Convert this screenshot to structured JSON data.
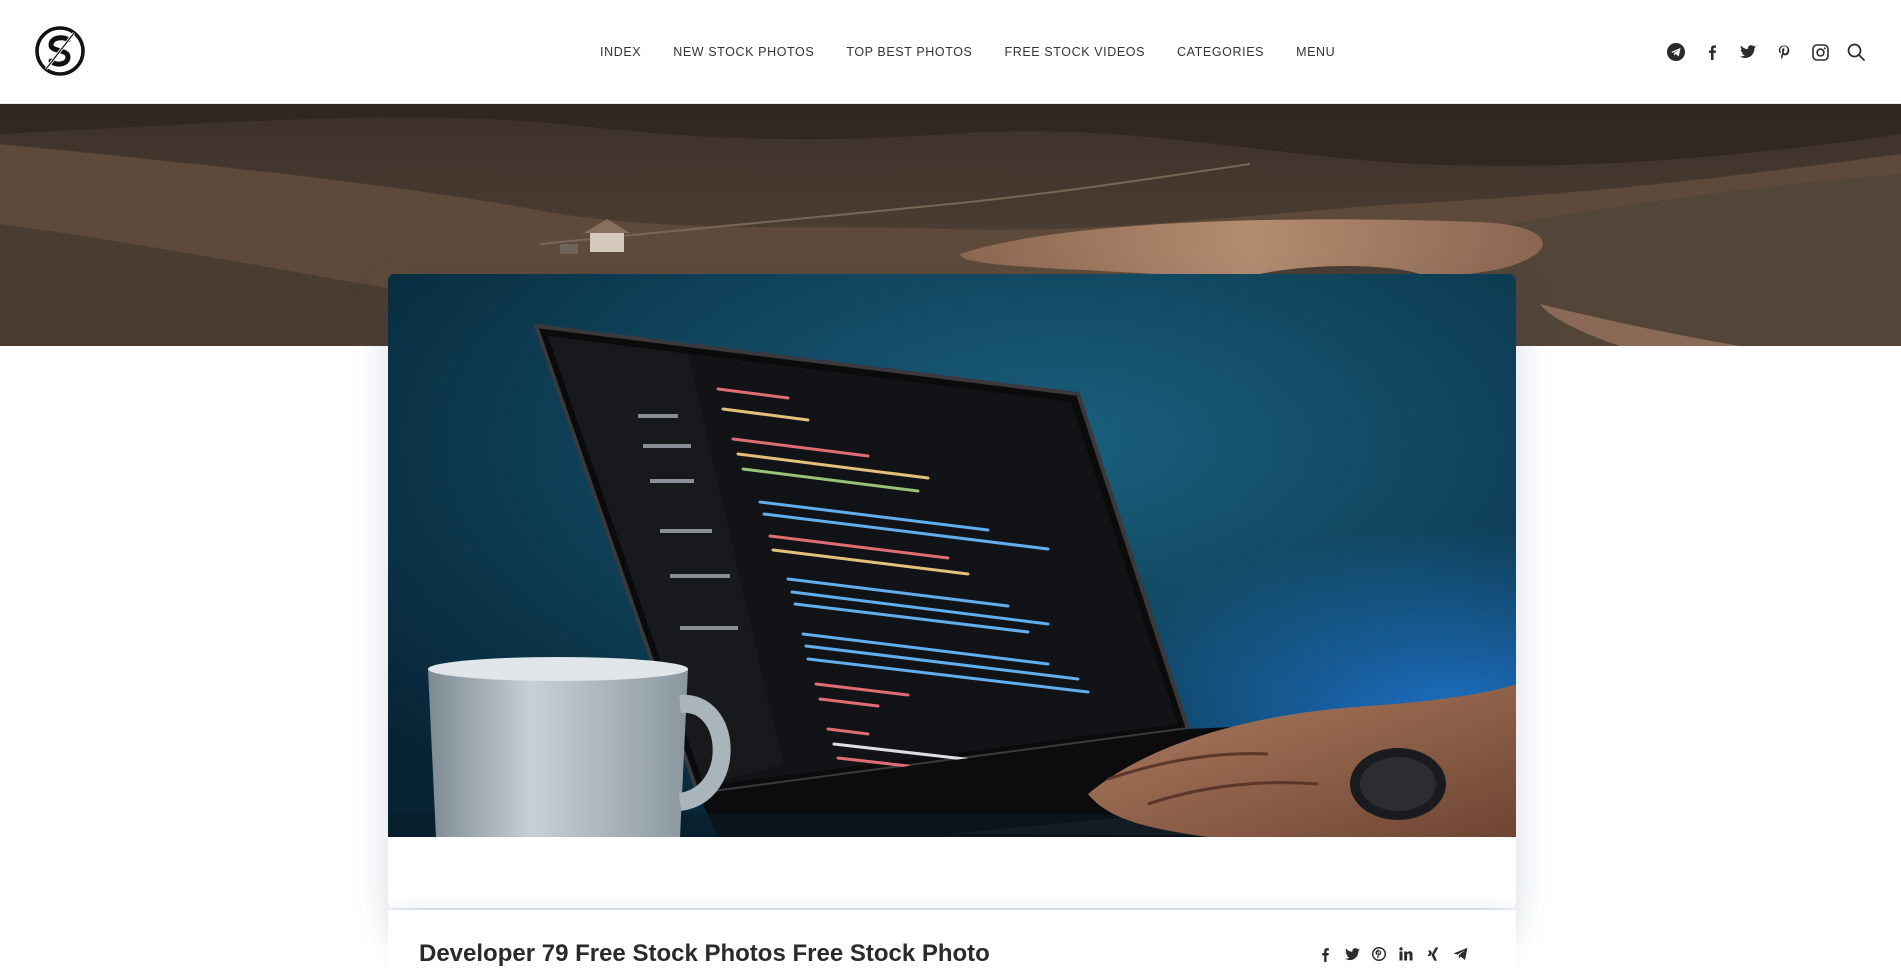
{
  "nav": {
    "items": [
      {
        "label": "INDEX"
      },
      {
        "label": "NEW STOCK PHOTOS"
      },
      {
        "label": "TOP BEST PHOTOS"
      },
      {
        "label": "FREE STOCK VIDEOS"
      },
      {
        "label": "CATEGORIES"
      },
      {
        "label": "MENU"
      }
    ]
  },
  "header_icons": [
    "logo-icon",
    "telegram-icon",
    "facebook-icon",
    "twitter-icon",
    "pinterest-icon",
    "instagram-icon",
    "search-icon"
  ],
  "post": {
    "title": "Developer 79 Free Stock Photos Free Stock Photo"
  },
  "share_icons": [
    "facebook-icon",
    "twitter-icon",
    "pinterest-icon",
    "linkedin-icon",
    "xing-icon",
    "telegram-icon"
  ],
  "colors": {
    "text": "#2a2a2a",
    "nav_text": "#333333",
    "icon": "#2b2b2b"
  }
}
